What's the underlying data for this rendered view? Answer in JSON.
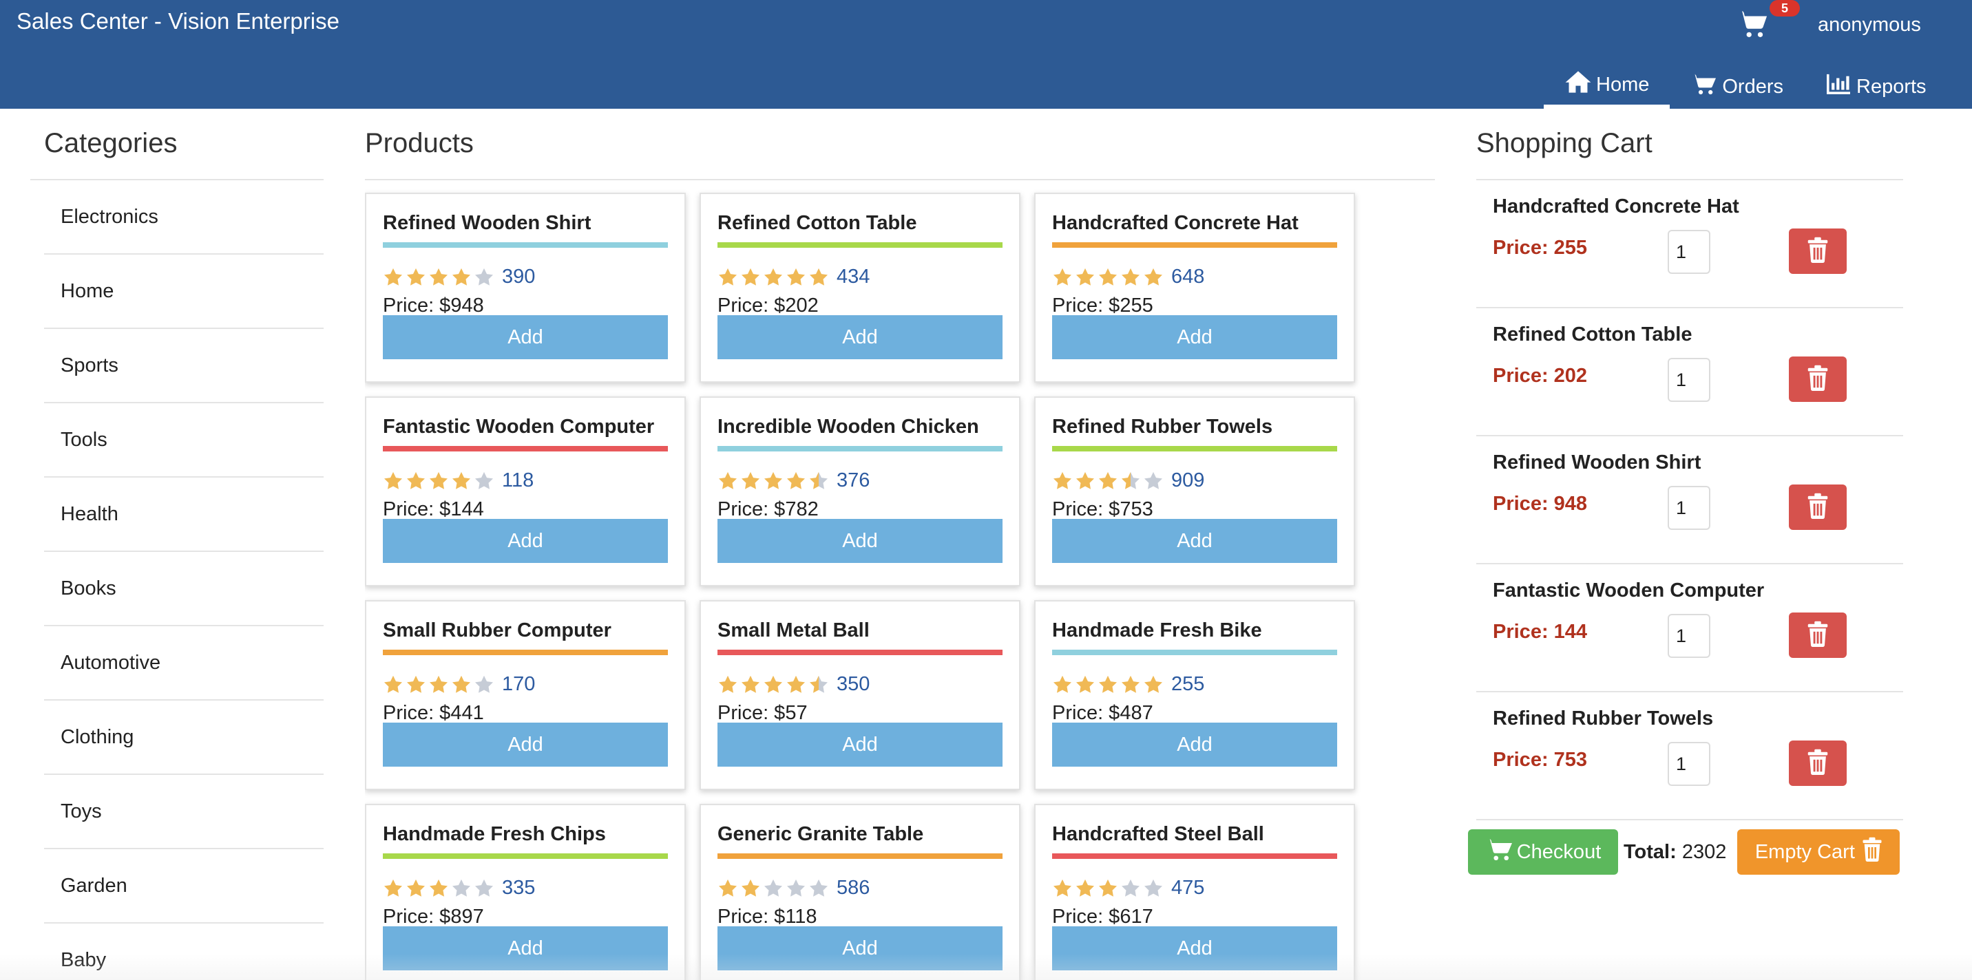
{
  "app": {
    "title": "Sales Center - Vision Enterprise",
    "user": "anonymous",
    "cart_count": "5"
  },
  "nav": [
    {
      "label": "Home",
      "icon": "home-icon",
      "active": true
    },
    {
      "label": "Orders",
      "icon": "cart-icon",
      "active": false
    },
    {
      "label": "Reports",
      "icon": "bar-chart-icon",
      "active": false
    }
  ],
  "categories": {
    "title": "Categories",
    "items": [
      "Electronics",
      "Home",
      "Sports",
      "Tools",
      "Health",
      "Books",
      "Automotive",
      "Clothing",
      "Toys",
      "Garden",
      "Baby"
    ]
  },
  "products": {
    "title": "Products",
    "add_label": "Add",
    "items": [
      {
        "name": "Refined Wooden Shirt",
        "color": "#8fd0de",
        "stars": 4,
        "rating": "390",
        "price": "Price: $948"
      },
      {
        "name": "Refined Cotton Table",
        "color": "#a8d84a",
        "stars": 5,
        "rating": "434",
        "price": "Price: $202"
      },
      {
        "name": "Handcrafted Concrete Hat",
        "color": "#f0a23c",
        "stars": 5,
        "rating": "648",
        "price": "Price: $255"
      },
      {
        "name": "Fantastic Wooden Computer",
        "color": "#e8585a",
        "stars": 4,
        "rating": "118",
        "price": "Price: $144"
      },
      {
        "name": "Incredible Wooden Chicken",
        "color": "#8fd0de",
        "stars": 4.5,
        "rating": "376",
        "price": "Price: $782"
      },
      {
        "name": "Refined Rubber Towels",
        "color": "#a8d84a",
        "stars": 3.5,
        "rating": "909",
        "price": "Price: $753"
      },
      {
        "name": "Small Rubber Computer",
        "color": "#f0a23c",
        "stars": 4,
        "rating": "170",
        "price": "Price: $441"
      },
      {
        "name": "Small Metal Ball",
        "color": "#e8585a",
        "stars": 4.5,
        "rating": "350",
        "price": "Price: $57"
      },
      {
        "name": "Handmade Fresh Bike",
        "color": "#8fd0de",
        "stars": 5,
        "rating": "255",
        "price": "Price: $487"
      },
      {
        "name": "Handmade Fresh Chips",
        "color": "#a8d84a",
        "stars": 3,
        "rating": "335",
        "price": "Price: $897"
      },
      {
        "name": "Generic Granite Table",
        "color": "#f0a23c",
        "stars": 2,
        "rating": "586",
        "price": "Price: $118"
      },
      {
        "name": "Handcrafted Steel Ball",
        "color": "#e8585a",
        "stars": 3,
        "rating": "475",
        "price": "Price: $617"
      }
    ]
  },
  "cart": {
    "title": "Shopping Cart",
    "items": [
      {
        "name": "Handcrafted Concrete Hat",
        "price": "Price: 255",
        "qty": "1"
      },
      {
        "name": "Refined Cotton Table",
        "price": "Price: 202",
        "qty": "1"
      },
      {
        "name": "Refined Wooden Shirt",
        "price": "Price: 948",
        "qty": "1"
      },
      {
        "name": "Fantastic Wooden Computer",
        "price": "Price: 144",
        "qty": "1"
      },
      {
        "name": "Refined Rubber Towels",
        "price": "Price: 753",
        "qty": "1"
      }
    ],
    "checkout_label": "Checkout",
    "total_label": "Total:",
    "total_value": "2302",
    "empty_label": "Empty Cart"
  },
  "colors": {
    "header": "#2d5a94",
    "add_button": "#6eb0dd",
    "delete_button": "#d6524d",
    "checkout": "#5cb85c",
    "empty_cart": "#f0952b",
    "price_red": "#b0321e",
    "star_full": "#f0b955",
    "star_empty": "#c6ccd6"
  }
}
